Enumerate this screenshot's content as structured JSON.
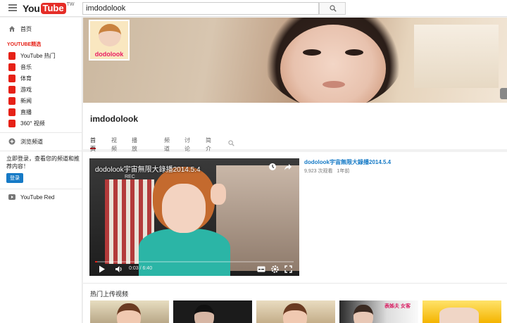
{
  "header": {
    "logo_you": "You",
    "logo_tube": "Tube",
    "logo_region": "TW",
    "search_value": "imdodolook"
  },
  "sidebar": {
    "home": "首页",
    "section_title": "YOUTUBE精选",
    "items": [
      {
        "label": "YouTube 热门",
        "icon": "youtube-play-icon"
      },
      {
        "label": "音乐",
        "icon": "headphones-icon"
      },
      {
        "label": "体育",
        "icon": "trophy-icon"
      },
      {
        "label": "游戏",
        "icon": "gamepad-icon"
      },
      {
        "label": "新闻",
        "icon": "newspaper-icon"
      },
      {
        "label": "直播",
        "icon": "live-icon"
      },
      {
        "label": "360° 视频",
        "icon": "360-icon"
      }
    ],
    "browse": "浏览频道",
    "login_prompt": "立即登录，查看您的频道和推荐内容！",
    "login_button": "登录",
    "red": "YouTube Red"
  },
  "channel": {
    "avatar_label": "dodolook",
    "name": "imdodolook",
    "tabs": [
      "首页",
      "视频",
      "播放列表",
      "频道",
      "讨论",
      "简介"
    ],
    "active_tab": 0
  },
  "featured": {
    "player_title": "dodolook宇宙無限大錄播2014.5.4",
    "rec_label": "REC",
    "current_time": "0:03",
    "duration": "6:40",
    "progress": 0.01,
    "title": "dodolook宇宙無限大錄播2014.5.4",
    "views": "9,923 次观看",
    "age": "1年前"
  },
  "popular": {
    "title": "热门上传视频",
    "thumb_text": "表姊夫 女客"
  },
  "colors": {
    "brand_red": "#e62117",
    "link_blue": "#167ac6"
  }
}
